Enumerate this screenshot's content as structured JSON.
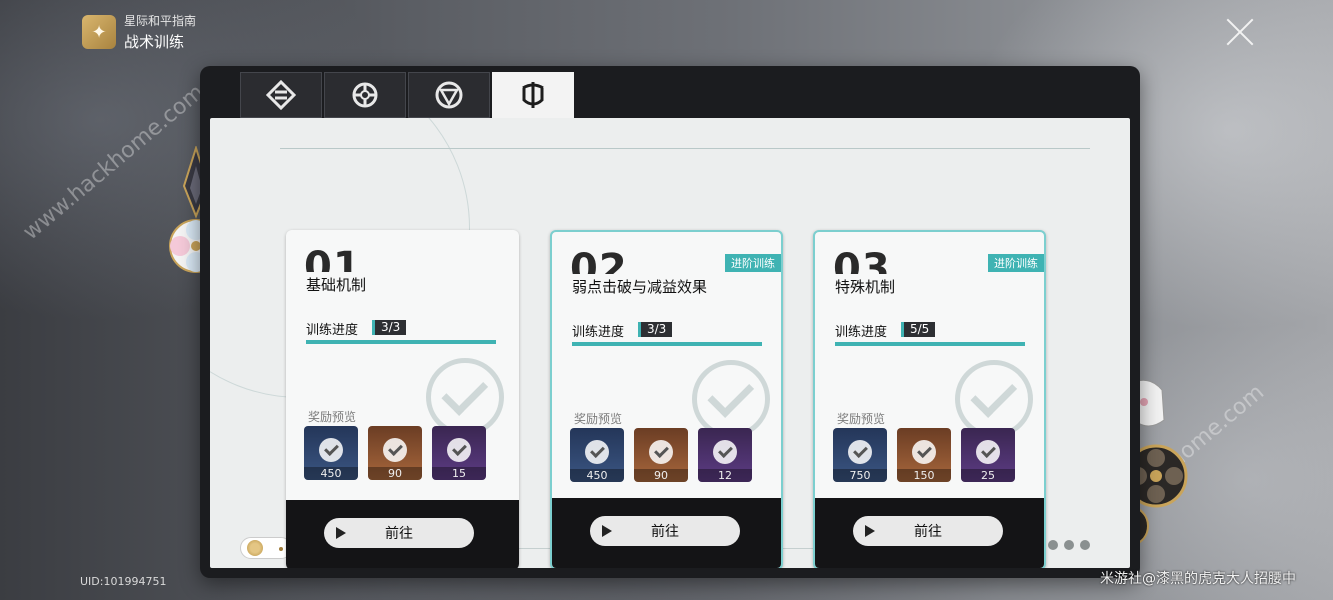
{
  "header": {
    "subtitle": "星际和平指南",
    "title": "战术训练"
  },
  "tabs": [
    {
      "icon": "diamond-shield-icon",
      "active": false
    },
    {
      "icon": "flower-gear-icon",
      "active": false
    },
    {
      "icon": "triangle-circle-icon",
      "active": false
    },
    {
      "icon": "trident-icon",
      "active": true
    }
  ],
  "cards": [
    {
      "number": "01",
      "badge": "",
      "name": "基础机制",
      "progress_label": "训练进度",
      "progress": "3/3",
      "progress_fraction": 1.0,
      "rewards_label": "奖励预览",
      "rewards": [
        {
          "count": "450",
          "color": "blue"
        },
        {
          "count": "90",
          "color": "brown"
        },
        {
          "count": "15",
          "color": "purple"
        }
      ],
      "button": "前往"
    },
    {
      "number": "02",
      "badge": "进阶训练",
      "name": "弱点击破与减益效果",
      "progress_label": "训练进度",
      "progress": "3/3",
      "progress_fraction": 1.0,
      "rewards_label": "奖励预览",
      "rewards": [
        {
          "count": "450",
          "color": "blue"
        },
        {
          "count": "90",
          "color": "brown"
        },
        {
          "count": "12",
          "color": "purple"
        }
      ],
      "button": "前往"
    },
    {
      "number": "03",
      "badge": "进阶训练",
      "name": "特殊机制",
      "progress_label": "训练进度",
      "progress": "5/5",
      "progress_fraction": 1.0,
      "rewards_label": "奖励预览",
      "rewards": [
        {
          "count": "750",
          "color": "blue"
        },
        {
          "count": "150",
          "color": "brown"
        },
        {
          "count": "25",
          "color": "purple"
        }
      ],
      "button": "前往"
    }
  ],
  "uid": "UID:101994751",
  "credit": "米游社@漆黑的虎克大人招腰中",
  "watermark": "www.hackhome.com",
  "colors": {
    "accent": "#3fb3b3",
    "panel": "#1b1c1f",
    "card": "#f7f8f8"
  }
}
